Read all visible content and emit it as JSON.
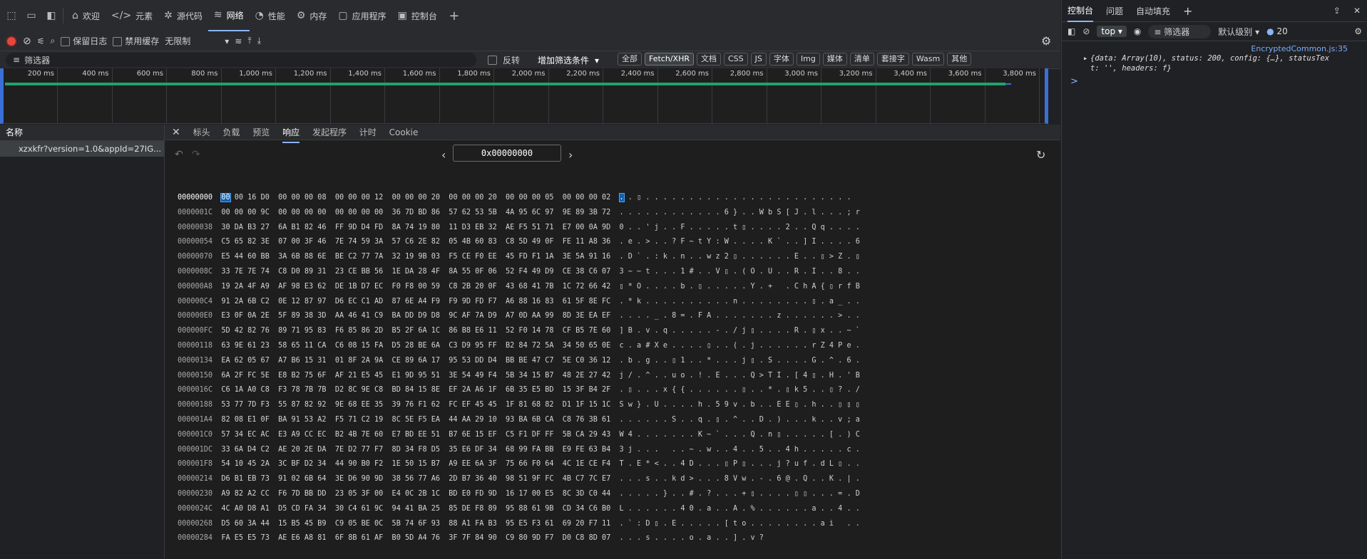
{
  "tabs": {
    "welcome": "欢迎",
    "elements": "元素",
    "sources": "源代码",
    "network": "网络",
    "performance": "性能",
    "memory": "内存",
    "application": "应用程序",
    "console": "控制台"
  },
  "toolbar": {
    "preserve_log": "保留日志",
    "disable_cache": "禁用缓存",
    "throttling": "无限制"
  },
  "filter": {
    "placeholder": "筛选器",
    "invert": "反转",
    "more_filters": "增加筛选条件",
    "types": [
      "全部",
      "Fetch/XHR",
      "文档",
      "CSS",
      "JS",
      "字体",
      "Img",
      "媒体",
      "清单",
      "套接字",
      "Wasm",
      "其他"
    ]
  },
  "timeline": {
    "labels": [
      "200 ms",
      "400 ms",
      "600 ms",
      "800 ms",
      "1,000 ms",
      "1,200 ms",
      "1,400 ms",
      "1,600 ms",
      "1,800 ms",
      "2,000 ms",
      "2,200 ms",
      "2,400 ms",
      "2,600 ms",
      "2,800 ms",
      "3,000 ms",
      "3,200 ms",
      "3,400 ms",
      "3,600 ms",
      "3,800 ms"
    ]
  },
  "names": {
    "header": "名称",
    "rows": [
      "xzxkfr?version=1.0&appId=27IG..."
    ]
  },
  "detail_tabs": [
    "标头",
    "负载",
    "预览",
    "响应",
    "发起程序",
    "计时",
    "Cookie"
  ],
  "hex": {
    "offset_input": "0x00000000",
    "rows": [
      {
        "addr": "00000000",
        "bytes": "00 00 16 D0  00 00 00 08  00 00 00 12  00 00 00 20  00 00 00 20  00 00 00 05  00 00 00 02",
        "ascii": ". . ▯ . . . . . . . . . . . . . . . . . . . . . . . ."
      },
      {
        "addr": "0000001C",
        "bytes": "00 00 00 9C  00 00 00 00  00 00 00 00  36 7D BD 86  57 62 53 5B  4A 95 6C 97  9E 89 3B 72",
        "ascii": ". . . . . . . . . . . . 6 } . . W b S [ J . l . . . ; r"
      },
      {
        "addr": "00000038",
        "bytes": "30 DA B3 27  6A B1 82 46  FF 9D D4 FD  8A 74 19 80  11 D3 EB 32  AE F5 51 71  E7 00 0A 9D",
        "ascii": "0 . . ' j . . F . . . . . t ▯ . . . . 2 . . Q q . . . ."
      },
      {
        "addr": "00000054",
        "bytes": "C5 65 82 3E  07 00 3F 46  7E 74 59 3A  57 C6 2E 82  05 4B 60 83  C8 5D 49 0F  FE 11 A8 36",
        "ascii": ". e . > . . ? F ~ t Y : W . . . . K ` . . ] I . . . . 6"
      },
      {
        "addr": "00000070",
        "bytes": "E5 44 60 BB  3A 6B 88 6E  BE C2 77 7A  32 19 9B 03  F5 CE F0 EE  45 FD F1 1A  3E 5A 91 16",
        "ascii": ". D ` . : k . n . . w z 2 ▯ . . . . . . E . . ▯ > Z . ▯"
      },
      {
        "addr": "0000008C",
        "bytes": "33 7E 7E 74  C8 D0 89 31  23 CE BB 56  1E DA 28 4F  8A 55 0F 06  52 F4 49 D9  CE 38 C6 07",
        "ascii": "3 ~ ~ t . . . 1 # . . V ▯ . ( O . U . . R . I . . 8 . ."
      },
      {
        "addr": "000000A8",
        "bytes": "19 2A 4F A9  AF 98 E3 62  DE 1B D7 EC  F0 F8 00 59  C8 2B 20 0F  43 68 41 7B  1C 72 66 42",
        "ascii": "▯ * O . . . . b . ▯ . . . . . Y . +   . C h A { ▯ r f B"
      },
      {
        "addr": "000000C4",
        "bytes": "91 2A 6B C2  0E 12 87 97  D6 EC C1 AD  87 6E A4 F9  F9 9D FD F7  A6 88 16 83  61 5F 8E FC",
        "ascii": ". * k . . . . . . . . . . n . . . . . . . . ▯ . a _ . ."
      },
      {
        "addr": "000000E0",
        "bytes": "E3 0F 0A 2E  5F 89 38 3D  AA 46 41 C9  BA DD D9 D8  9C AF 7A D9  A7 0D AA 99  8D 3E EA EF",
        "ascii": ". . . . _ . 8 = . F A . . . . . . . z . . . . . . > . ."
      },
      {
        "addr": "000000FC",
        "bytes": "5D 42 82 76  89 71 95 83  F6 85 86 2D  B5 2F 6A 1C  86 B8 E6 11  52 F0 14 78  CF B5 7E 60",
        "ascii": "] B . v . q . . . . . - . / j ▯ . . . . R . ▯ x . . ~ `"
      },
      {
        "addr": "00000118",
        "bytes": "63 9E 61 23  58 65 11 CA  C6 08 15 FA  D5 28 BE 6A  C3 D9 95 FF  B2 84 72 5A  34 50 65 0E",
        "ascii": "c . a # X e . . . . ▯ . . ( . j . . . . . . r Z 4 P e ."
      },
      {
        "addr": "00000134",
        "bytes": "EA 62 05 67  A7 B6 15 31  01 8F 2A 9A  CE 89 6A 17  95 53 DD D4  BB BE 47 C7  5E C0 36 12",
        "ascii": ". b . g . . ▯ 1 . . * . . . j ▯ . S . . . . G . ^ . 6 ."
      },
      {
        "addr": "00000150",
        "bytes": "6A 2F FC 5E  E8 B2 75 6F  AF 21 E5 45  E1 9D 95 51  3E 54 49 F4  5B 34 15 B7  48 2E 27 42",
        "ascii": "j / . ^ . . u o . ! . E . . . Q > T I . [ 4 ▯ . H . ' B"
      },
      {
        "addr": "0000016C",
        "bytes": "C6 1A A0 C8  F3 78 7B 7B  D2 8C 9E C8  BD 84 15 8E  EF 2A A6 1F  6B 35 E5 BD  15 3F B4 2F",
        "ascii": ". ▯ . . . x { { . . . . . . ▯ . . * . ▯ k 5 . . ▯ ? . /"
      },
      {
        "addr": "00000188",
        "bytes": "53 77 7D F3  55 87 82 92  9E 68 EE 35  39 76 F1 62  FC EF 45 45  1F 81 68 82  D1 1F 15 1C",
        "ascii": "S w } . U . . . . h . 5 9 v . b . . E E ▯ . h . . ▯ ▯ ▯"
      },
      {
        "addr": "000001A4",
        "bytes": "82 08 E1 0F  BA 91 53 A2  F5 71 C2 19  8C 5E F5 EA  44 AA 29 10  93 BA 6B CA  C8 76 3B 61",
        "ascii": ". . . . . . S . . q . ▯ . ^ . . D . ) . . . k . . v ; a"
      },
      {
        "addr": "000001C0",
        "bytes": "57 34 EC AC  E3 A9 CC EC  B2 4B 7E 60  E7 BD EE 51  B7 6E 15 EF  C5 F1 DF FF  5B CA 29 43",
        "ascii": "W 4 . . . . . . . K ~ ` . . . Q . n ▯ . . . . . [ . ) C"
      },
      {
        "addr": "000001DC",
        "bytes": "33 6A D4 C2  AE 20 2E DA  7E D2 77 F7  8D 34 F8 D5  35 E6 DF 34  68 99 FA BB  E9 FE 63 B4",
        "ascii": "3 j . . .   . . ~ . w . . 4 . . 5 . . 4 h . . . . . c ."
      },
      {
        "addr": "000001F8",
        "bytes": "54 10 45 2A  3C BF D2 34  44 90 B0 F2  1E 50 15 B7  A9 EE 6A 3F  75 66 F0 64  4C 1E CE F4",
        "ascii": "T . E * < . . 4 D . . . ▯ P ▯ . . . j ? u f . d L ▯ . ."
      },
      {
        "addr": "00000214",
        "bytes": "D6 B1 EB 73  91 02 6B 64  3E D6 90 9D  38 56 77 A6  2D B7 36 40  98 51 9F FC  4B C7 7C E7",
        "ascii": ". . . s . . k d > . . . 8 V w . - . 6 @ . Q . . K . | ."
      },
      {
        "addr": "00000230",
        "bytes": "A9 82 A2 CC  F6 7D BB DD  23 05 3F 00  E4 0C 2B 1C  BD E0 FD 9D  16 17 00 E5  8C 3D C0 44",
        "ascii": ". . . . . } . . # . ? . . . + ▯ . . . . ▯ ▯ . . . = . D"
      },
      {
        "addr": "0000024C",
        "bytes": "4C A0 D8 A1  D5 CD FA 34  30 C4 61 9C  94 41 BA 25  85 DE F8 89  95 88 61 9B  CD 34 C6 B0",
        "ascii": "L . . . . . . 4 0 . a . . A . % . . . . . . a . . 4 . ."
      },
      {
        "addr": "00000268",
        "bytes": "D5 60 3A 44  15 B5 45 B9  C9 05 BE 0C  5B 74 6F 93  88 A1 FA B3  95 E5 F3 61  69 20 F7 11",
        "ascii": ". ` : D ▯ . E . . . . . [ t o . . . . . . . . a i   . ."
      },
      {
        "addr": "00000284",
        "bytes": "FA E5 E5 73  AE E6 A8 81  6F 8B 61 AF  B0 5D A4 76  3F 7F 84 90  C9 80 9D F7  D0 C8 8D 07",
        "ascii": ". . . s . . . . o . a . . ] . v ?"
      }
    ]
  },
  "console": {
    "tabs": [
      "控制台",
      "问题",
      "自动填充"
    ],
    "context": "top",
    "filter_placeholder": "筛选器",
    "level": "默认级别",
    "issue_count": "20",
    "source_link": "EncryptedCommon.js:35",
    "log_line1": "{data: Array(10), status: 200, config: {…}, statusTex",
    "log_line2": "t: '', headers: f}",
    "prompt": ">"
  },
  "colors": {
    "accent": "#8ab4f8",
    "timeline_bar": "#1ea36a",
    "timeline_border": "#3a6fd8",
    "record": "#e8453c"
  }
}
